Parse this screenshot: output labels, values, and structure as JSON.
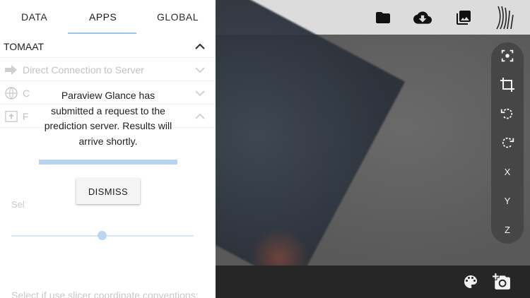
{
  "tabs": [
    {
      "label": "DATA"
    },
    {
      "label": "APPS"
    },
    {
      "label": "GLOBAL"
    }
  ],
  "section": {
    "title": "TOMAAT"
  },
  "rows": [
    {
      "label": "Direct Connection to Server",
      "icon": "arrow-right-icon"
    },
    {
      "label": "C",
      "icon": "globe-icon"
    },
    {
      "label": "F",
      "icon": "upload-box-icon"
    }
  ],
  "panel": {
    "select_label_partial": "Sel",
    "slicer_label_partial": "Select if use slicer coordinate conventions:",
    "slider_value_fraction": 0.5
  },
  "dialog": {
    "message": "Paraview Glance has submitted a request to the prediction server. Results will arrive shortly.",
    "progress_fraction": 1.0,
    "dismiss_label": "DISMISS"
  },
  "toolbar_top": [
    "folder-icon",
    "cloud-download-icon",
    "image-gallery-icon",
    "glance-logo-icon"
  ],
  "side_tools": {
    "buttons": [
      "focus-icon",
      "crop-icon",
      "rotate-left-icon",
      "rotate-right-icon"
    ],
    "axis_x": "X",
    "axis_y": "Y",
    "axis_z": "Z"
  },
  "toolbar_bottom": [
    "palette-icon",
    "add-screenshot-icon"
  ],
  "colors": {
    "accent": "#9fc3e8",
    "viewer_bg": "#5d5d5d",
    "topbar_bg": "#dcdcdc",
    "bottombar_bg": "#262626",
    "tools_bg": "#464646"
  }
}
